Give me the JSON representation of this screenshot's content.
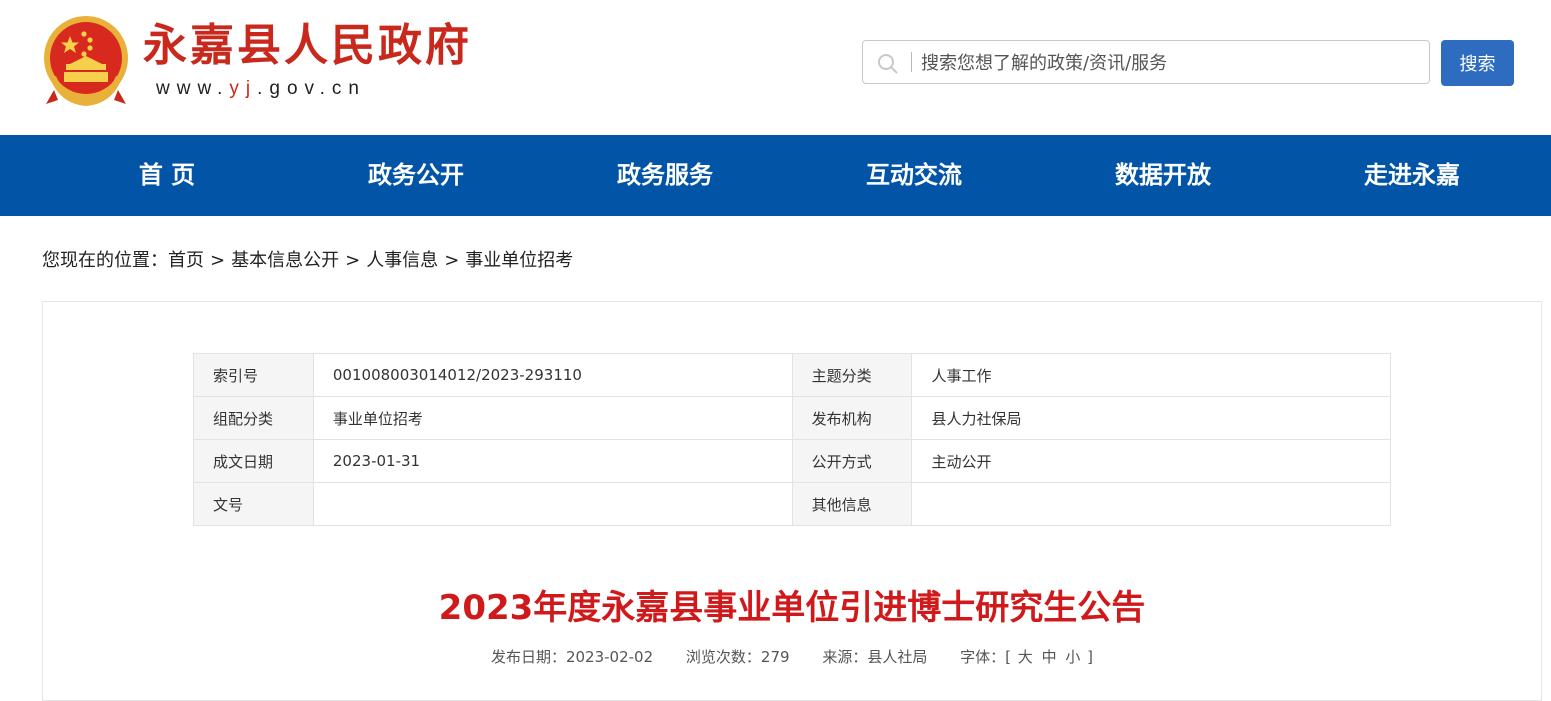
{
  "header": {
    "site_title": "永嘉县人民政府",
    "url_prefix": "www.",
    "url_highlight": "yj",
    "url_suffix": ".gov.cn",
    "search_placeholder": "搜索您想了解的政策/资讯/服务",
    "search_button": "搜索"
  },
  "nav": {
    "items": [
      "首 页",
      "政务公开",
      "政务服务",
      "互动交流",
      "数据开放",
      "走进永嘉"
    ]
  },
  "breadcrumb": {
    "label": "您现在的位置：",
    "items": [
      "首页",
      "基本信息公开",
      "人事信息",
      "事业单位招考"
    ],
    "separator": ">"
  },
  "info_table": {
    "rows": [
      {
        "k1": "索引号",
        "v1": "001008003014012/2023-293110",
        "k2": "主题分类",
        "v2": "人事工作"
      },
      {
        "k1": "组配分类",
        "v1": "事业单位招考",
        "k2": "发布机构",
        "v2": "县人力社保局"
      },
      {
        "k1": "成文日期",
        "v1": "2023-01-31",
        "k2": "公开方式",
        "v2": "主动公开"
      },
      {
        "k1": "文号",
        "v1": "",
        "k2": "其他信息",
        "v2": ""
      }
    ]
  },
  "article": {
    "title": "2023年度永嘉县事业单位引进博士研究生公告",
    "publish_date": "发布日期：2023-02-02",
    "views": "浏览次数：279",
    "source": "来源：县人社局",
    "font_label": "字体：[",
    "font_large": "大",
    "font_medium": "中",
    "font_small": "小",
    "font_close": "]"
  },
  "colors": {
    "brand_red": "#c9291d",
    "nav_blue": "#0254a6",
    "button_blue": "#2e6cc0",
    "title_red": "#d0191b"
  }
}
